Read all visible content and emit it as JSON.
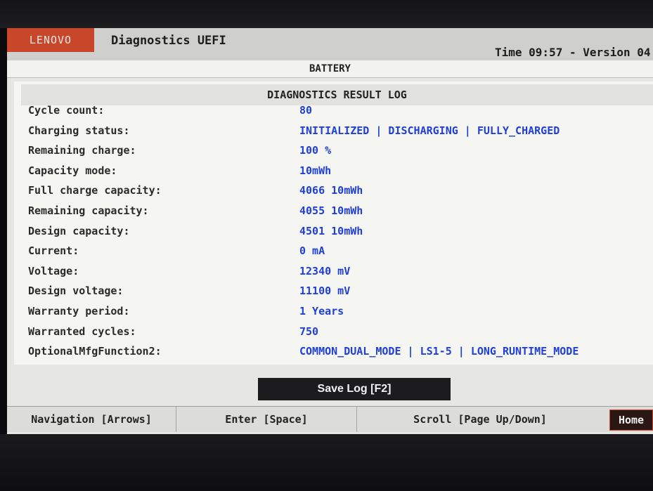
{
  "header": {
    "brand": "LENOVO",
    "app_title": "Diagnostics UEFI",
    "time_version": "Time 09:57 - Version 04"
  },
  "section": {
    "title": "BATTERY"
  },
  "log": {
    "title": "DIAGNOSTICS RESULT LOG",
    "rows": [
      {
        "label": "Cycle count:",
        "value": "80"
      },
      {
        "label": "Charging status:",
        "value": "INITIALIZED | DISCHARGING | FULLY_CHARGED"
      },
      {
        "label": "Remaining charge:",
        "value": "100 %"
      },
      {
        "label": "Capacity mode:",
        "value": "10mWh"
      },
      {
        "label": "Full charge capacity:",
        "value": "4066 10mWh"
      },
      {
        "label": "Remaining capacity:",
        "value": "4055 10mWh"
      },
      {
        "label": "Design capacity:",
        "value": "4501 10mWh"
      },
      {
        "label": "Current:",
        "value": "0 mA"
      },
      {
        "label": "Voltage:",
        "value": "12340 mV"
      },
      {
        "label": "Design voltage:",
        "value": "11100 mV"
      },
      {
        "label": "Warranty period:",
        "value": "1 Years"
      },
      {
        "label": "Warranted cycles:",
        "value": "750"
      },
      {
        "label": "OptionalMfgFunction2:",
        "value": "COMMON_DUAL_MODE | LS1-5 | LONG_RUNTIME_MODE"
      }
    ]
  },
  "actions": {
    "save_log": "Save Log [F2]"
  },
  "footer": {
    "navigation": "Navigation [Arrows]",
    "enter": "Enter [Space]",
    "scroll": "Scroll [Page Up/Down]",
    "home": "Home"
  },
  "colors": {
    "brand": "#c8462a",
    "value_text": "#1f3fd6",
    "button_bg": "#1c1c1e"
  }
}
